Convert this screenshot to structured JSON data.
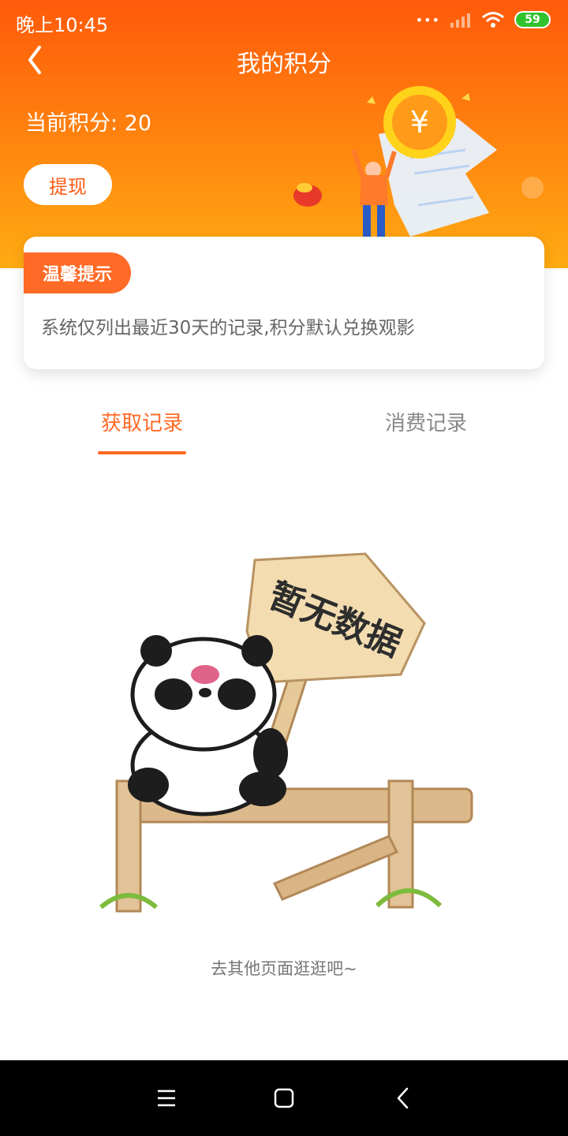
{
  "status_bar": {
    "time": "晚上10:45",
    "dots": "•••",
    "battery": "59"
  },
  "header": {
    "title": "我的积分",
    "points_text": "当前积分: 20",
    "withdraw_label": "提现"
  },
  "notice": {
    "badge": "温馨提示",
    "text": "系统仅列出最近30天的记录,积分默认兑换观影"
  },
  "tabs": [
    {
      "label": "获取记录",
      "active": true
    },
    {
      "label": "消费记录",
      "active": false
    }
  ],
  "empty_state": {
    "sign_text": "暂无数据",
    "message": "去其他页面逛逛吧~"
  },
  "icons": {
    "back": "chevron-left-icon",
    "signal": "signal-icon",
    "wifi": "wifi-icon",
    "menu": "menu-icon",
    "home": "home-square-icon",
    "nav_back": "nav-back-icon"
  },
  "colors": {
    "accent": "#ff6a26",
    "header_top": "#ff5a0a",
    "header_bottom": "#ffab12",
    "battery": "#31c22e"
  }
}
